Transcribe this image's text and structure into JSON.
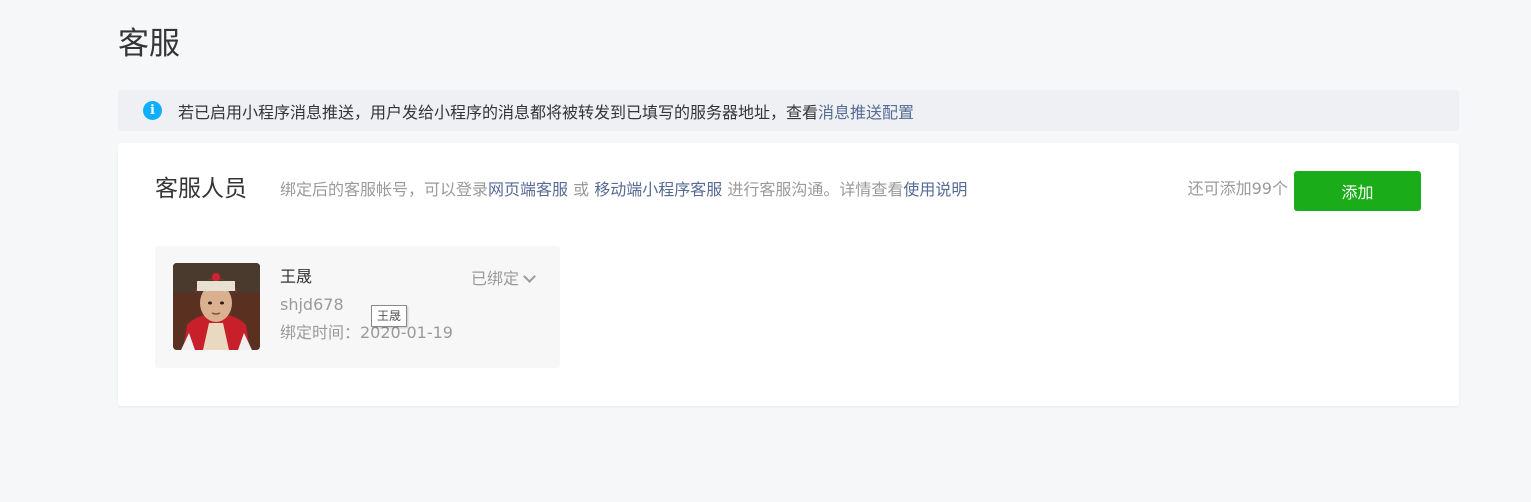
{
  "page": {
    "title": "客服"
  },
  "notice": {
    "icon": "info-icon",
    "text": "若已启用小程序消息推送，用户发给小程序的消息都将被转发到已填写的服务器地址，查看 ",
    "link_label": "消息推送配置"
  },
  "section": {
    "title": "客服人员",
    "desc_part1": "绑定后的客服帐号，可以登录",
    "link_web": "网页端客服",
    "desc_or": " 或 ",
    "link_mobile": "移动端小程序客服",
    "desc_part2": " 进行客服沟通。详情查看",
    "link_help": "使用说明",
    "quota": "还可添加99个",
    "add_label": "添加"
  },
  "staff": [
    {
      "name": "王晟",
      "account": "shjd678",
      "bind_time": "绑定时间：2020-01-19",
      "status": "已绑定",
      "tooltip": "王晟"
    }
  ],
  "colors": {
    "accent": "#1aad19",
    "link": "#576b95",
    "info": "#10aeff"
  }
}
